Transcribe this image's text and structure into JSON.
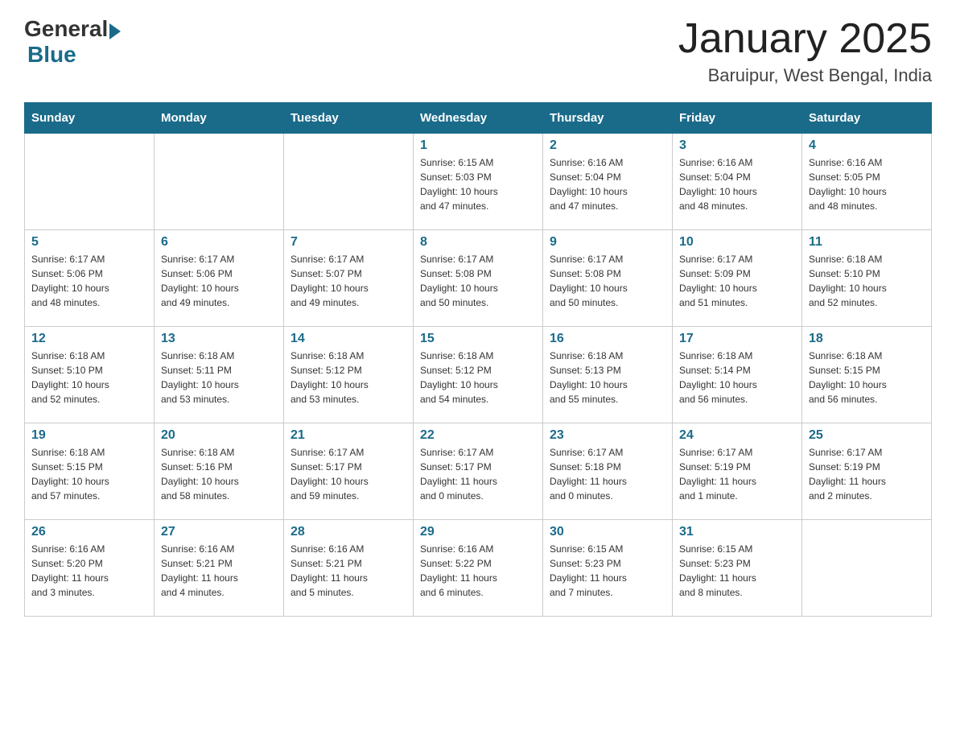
{
  "header": {
    "logo_general": "General",
    "logo_blue": "Blue",
    "month_title": "January 2025",
    "subtitle": "Baruipur, West Bengal, India"
  },
  "days_of_week": [
    "Sunday",
    "Monday",
    "Tuesday",
    "Wednesday",
    "Thursday",
    "Friday",
    "Saturday"
  ],
  "weeks": [
    [
      {
        "day": "",
        "info": ""
      },
      {
        "day": "",
        "info": ""
      },
      {
        "day": "",
        "info": ""
      },
      {
        "day": "1",
        "info": "Sunrise: 6:15 AM\nSunset: 5:03 PM\nDaylight: 10 hours\nand 47 minutes."
      },
      {
        "day": "2",
        "info": "Sunrise: 6:16 AM\nSunset: 5:04 PM\nDaylight: 10 hours\nand 47 minutes."
      },
      {
        "day": "3",
        "info": "Sunrise: 6:16 AM\nSunset: 5:04 PM\nDaylight: 10 hours\nand 48 minutes."
      },
      {
        "day": "4",
        "info": "Sunrise: 6:16 AM\nSunset: 5:05 PM\nDaylight: 10 hours\nand 48 minutes."
      }
    ],
    [
      {
        "day": "5",
        "info": "Sunrise: 6:17 AM\nSunset: 5:06 PM\nDaylight: 10 hours\nand 48 minutes."
      },
      {
        "day": "6",
        "info": "Sunrise: 6:17 AM\nSunset: 5:06 PM\nDaylight: 10 hours\nand 49 minutes."
      },
      {
        "day": "7",
        "info": "Sunrise: 6:17 AM\nSunset: 5:07 PM\nDaylight: 10 hours\nand 49 minutes."
      },
      {
        "day": "8",
        "info": "Sunrise: 6:17 AM\nSunset: 5:08 PM\nDaylight: 10 hours\nand 50 minutes."
      },
      {
        "day": "9",
        "info": "Sunrise: 6:17 AM\nSunset: 5:08 PM\nDaylight: 10 hours\nand 50 minutes."
      },
      {
        "day": "10",
        "info": "Sunrise: 6:17 AM\nSunset: 5:09 PM\nDaylight: 10 hours\nand 51 minutes."
      },
      {
        "day": "11",
        "info": "Sunrise: 6:18 AM\nSunset: 5:10 PM\nDaylight: 10 hours\nand 52 minutes."
      }
    ],
    [
      {
        "day": "12",
        "info": "Sunrise: 6:18 AM\nSunset: 5:10 PM\nDaylight: 10 hours\nand 52 minutes."
      },
      {
        "day": "13",
        "info": "Sunrise: 6:18 AM\nSunset: 5:11 PM\nDaylight: 10 hours\nand 53 minutes."
      },
      {
        "day": "14",
        "info": "Sunrise: 6:18 AM\nSunset: 5:12 PM\nDaylight: 10 hours\nand 53 minutes."
      },
      {
        "day": "15",
        "info": "Sunrise: 6:18 AM\nSunset: 5:12 PM\nDaylight: 10 hours\nand 54 minutes."
      },
      {
        "day": "16",
        "info": "Sunrise: 6:18 AM\nSunset: 5:13 PM\nDaylight: 10 hours\nand 55 minutes."
      },
      {
        "day": "17",
        "info": "Sunrise: 6:18 AM\nSunset: 5:14 PM\nDaylight: 10 hours\nand 56 minutes."
      },
      {
        "day": "18",
        "info": "Sunrise: 6:18 AM\nSunset: 5:15 PM\nDaylight: 10 hours\nand 56 minutes."
      }
    ],
    [
      {
        "day": "19",
        "info": "Sunrise: 6:18 AM\nSunset: 5:15 PM\nDaylight: 10 hours\nand 57 minutes."
      },
      {
        "day": "20",
        "info": "Sunrise: 6:18 AM\nSunset: 5:16 PM\nDaylight: 10 hours\nand 58 minutes."
      },
      {
        "day": "21",
        "info": "Sunrise: 6:17 AM\nSunset: 5:17 PM\nDaylight: 10 hours\nand 59 minutes."
      },
      {
        "day": "22",
        "info": "Sunrise: 6:17 AM\nSunset: 5:17 PM\nDaylight: 11 hours\nand 0 minutes."
      },
      {
        "day": "23",
        "info": "Sunrise: 6:17 AM\nSunset: 5:18 PM\nDaylight: 11 hours\nand 0 minutes."
      },
      {
        "day": "24",
        "info": "Sunrise: 6:17 AM\nSunset: 5:19 PM\nDaylight: 11 hours\nand 1 minute."
      },
      {
        "day": "25",
        "info": "Sunrise: 6:17 AM\nSunset: 5:19 PM\nDaylight: 11 hours\nand 2 minutes."
      }
    ],
    [
      {
        "day": "26",
        "info": "Sunrise: 6:16 AM\nSunset: 5:20 PM\nDaylight: 11 hours\nand 3 minutes."
      },
      {
        "day": "27",
        "info": "Sunrise: 6:16 AM\nSunset: 5:21 PM\nDaylight: 11 hours\nand 4 minutes."
      },
      {
        "day": "28",
        "info": "Sunrise: 6:16 AM\nSunset: 5:21 PM\nDaylight: 11 hours\nand 5 minutes."
      },
      {
        "day": "29",
        "info": "Sunrise: 6:16 AM\nSunset: 5:22 PM\nDaylight: 11 hours\nand 6 minutes."
      },
      {
        "day": "30",
        "info": "Sunrise: 6:15 AM\nSunset: 5:23 PM\nDaylight: 11 hours\nand 7 minutes."
      },
      {
        "day": "31",
        "info": "Sunrise: 6:15 AM\nSunset: 5:23 PM\nDaylight: 11 hours\nand 8 minutes."
      },
      {
        "day": "",
        "info": ""
      }
    ]
  ]
}
